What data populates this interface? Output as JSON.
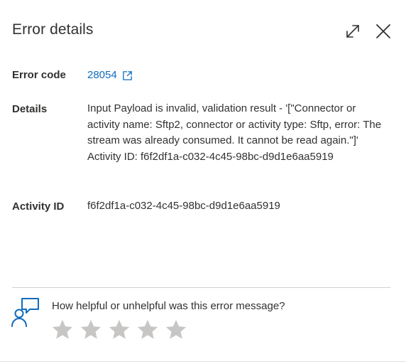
{
  "dialog": {
    "title": "Error details",
    "expand_icon": "expand-icon",
    "close_icon": "close-icon"
  },
  "fields": {
    "error_code_label": "Error code",
    "error_code_value": "28054",
    "details_label": "Details",
    "details_value": "Input Payload is invalid, validation result - '[\"Connector or activity name: Sftp2, connector or activity type: Sftp, error: The stream was already consumed. It cannot be read again.\"]' Activity ID: f6f2df1a-c032-4c45-98bc-d9d1e6aa5919",
    "activity_id_label": "Activity ID",
    "activity_id_value": "f6f2df1a-c032-4c45-98bc-d9d1e6aa5919"
  },
  "feedback": {
    "icon": "feedback-icon",
    "question": "How helpful or unhelpful was this error message?",
    "rating": 0,
    "max_rating": 5
  },
  "colors": {
    "link": "#0f6cbd",
    "text": "#323130",
    "star_empty": "#c8c6c4",
    "icon_blue": "#0f6cbd"
  }
}
